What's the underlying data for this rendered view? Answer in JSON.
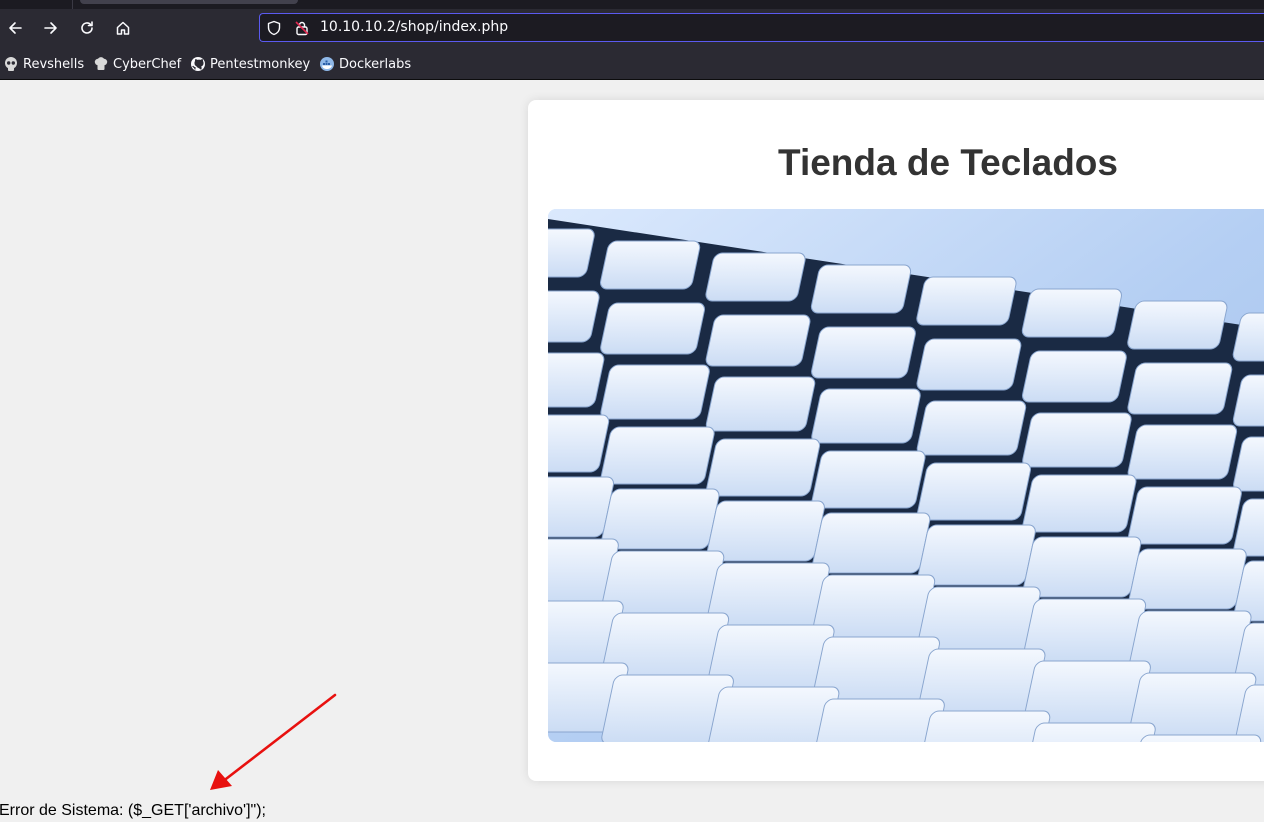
{
  "browser": {
    "url": "10.10.10.2/shop/index.php",
    "bookmarks": [
      {
        "label": "Revshells",
        "icon": "skull-icon"
      },
      {
        "label": "CyberChef",
        "icon": "chef-hat-icon"
      },
      {
        "label": "Pentestmonkey",
        "icon": "github-icon"
      },
      {
        "label": "Dockerlabs",
        "icon": "docker-icon"
      }
    ]
  },
  "page": {
    "title": "Tienda de Teclados",
    "error_message": "Error de Sistema: ($_GET['archivo']\");"
  },
  "colors": {
    "toolbar": "#2b2a33",
    "urlbar_focus": "#5b5af0",
    "page_bg": "#f0f0f0",
    "annotation_arrow": "#e8110f"
  }
}
